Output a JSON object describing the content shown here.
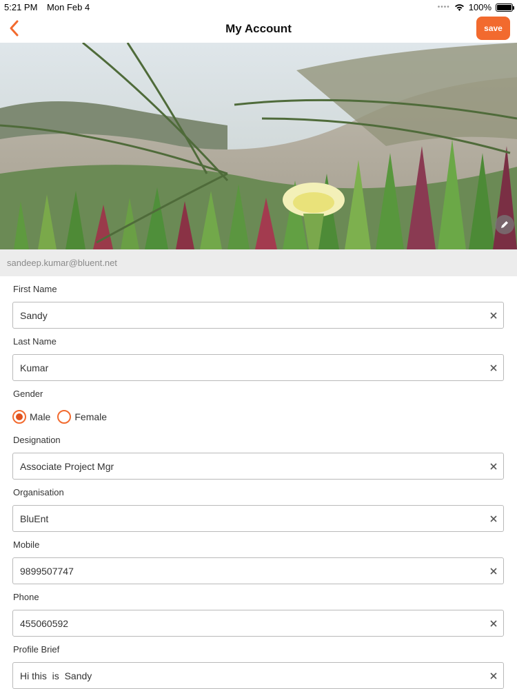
{
  "status_bar": {
    "time": "5:21 PM",
    "date": "Mon Feb 4",
    "battery": "100%"
  },
  "nav": {
    "title": "My Account",
    "save_label": "save"
  },
  "profile": {
    "email": "sandeep.kumar@bluent.net"
  },
  "form": {
    "first_name": {
      "label": "First Name",
      "value": "Sandy"
    },
    "last_name": {
      "label": "Last Name",
      "value": "Kumar"
    },
    "gender": {
      "label": "Gender",
      "options": [
        "Male",
        "Female"
      ],
      "selected": "Male"
    },
    "designation": {
      "label": "Designation",
      "value": "Associate Project Mgr"
    },
    "organisation": {
      "label": "Organisation",
      "value": "BluEnt"
    },
    "mobile": {
      "label": "Mobile",
      "value": "9899507747"
    },
    "phone": {
      "label": "Phone",
      "value": "455060592"
    },
    "profile_brief": {
      "label": "Profile Brief",
      "value": "Hi this  is  Sandy"
    }
  },
  "colors": {
    "accent": "#f26a2e",
    "strip": "#ececec",
    "field_border": "#b9b9b9"
  },
  "icons": {
    "back": "chevron-left-icon",
    "edit": "pencil-icon",
    "clear": "close-icon",
    "wifi": "wifi-icon",
    "battery": "battery-icon"
  }
}
